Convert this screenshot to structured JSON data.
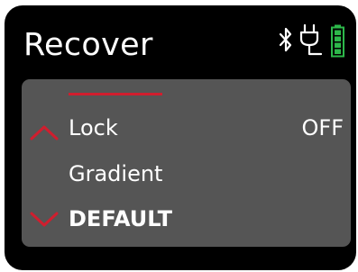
{
  "screen": {
    "title": "Recover"
  },
  "status": {
    "icons": [
      "bluetooth-icon",
      "plug-icon",
      "battery-icon"
    ],
    "battery_color": "#2db84a"
  },
  "menu": {
    "items": [
      {
        "label": "Lock",
        "value": "OFF"
      },
      {
        "label": "Gradient",
        "value": ""
      },
      {
        "label": "DEFAULT",
        "value": ""
      }
    ]
  },
  "colors": {
    "accent": "#d01e2e",
    "panel": "#555555",
    "background": "#000000",
    "text": "#ffffff"
  }
}
